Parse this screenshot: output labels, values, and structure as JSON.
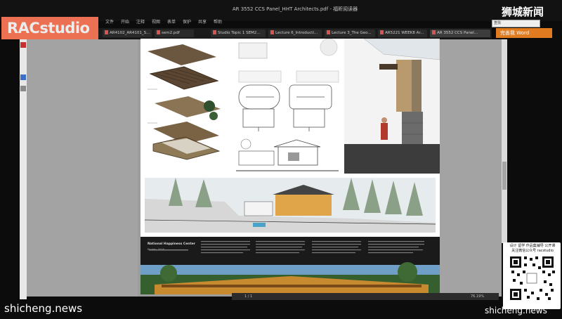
{
  "window": {
    "title": "AR 3552 CCS Panel_HHT Architects.pdf - 福昕阅读器"
  },
  "logo": {
    "text": "RACstudio"
  },
  "watermarks": {
    "top_right": "狮城新闻",
    "bottom_left": "shicheng.news",
    "bottom_right": "shicheng.news"
  },
  "menu": {
    "items": [
      "文件",
      "开始",
      "注释",
      "视图",
      "表单",
      "保护",
      "共享",
      "帮助"
    ]
  },
  "tabs": [
    {
      "label": "AR4102_AR4101_S..."
    },
    {
      "label": "sem2.pdf"
    },
    {
      "label": "Studio Topic 1 SEM2..."
    },
    {
      "label": "Lecture 6_Introducti..."
    },
    {
      "label": "Lecture 3_The Geo..."
    },
    {
      "label": "AR5221 WEEK8 Ar..."
    },
    {
      "label": "AR 3552 CCS Panel..."
    }
  ],
  "search": {
    "placeholder": "查找"
  },
  "login_button": {
    "label": "完善我 Word"
  },
  "status": {
    "page": "1 / 1",
    "zoom": "76.19%"
  },
  "qr": {
    "caption_1": "设计 留学 作品集辅导 公开课",
    "caption_2": "关注微信公众号 racstudio"
  },
  "document": {
    "board_title": "National Happiness Center",
    "board_subtitle": "Bhutan, 2018"
  },
  "colors": {
    "logo_bg": "#ff7a5a",
    "login_bg": "#e07b1f",
    "page_bg": "#ffffff",
    "viewer_bg": "#9c9c9c"
  }
}
